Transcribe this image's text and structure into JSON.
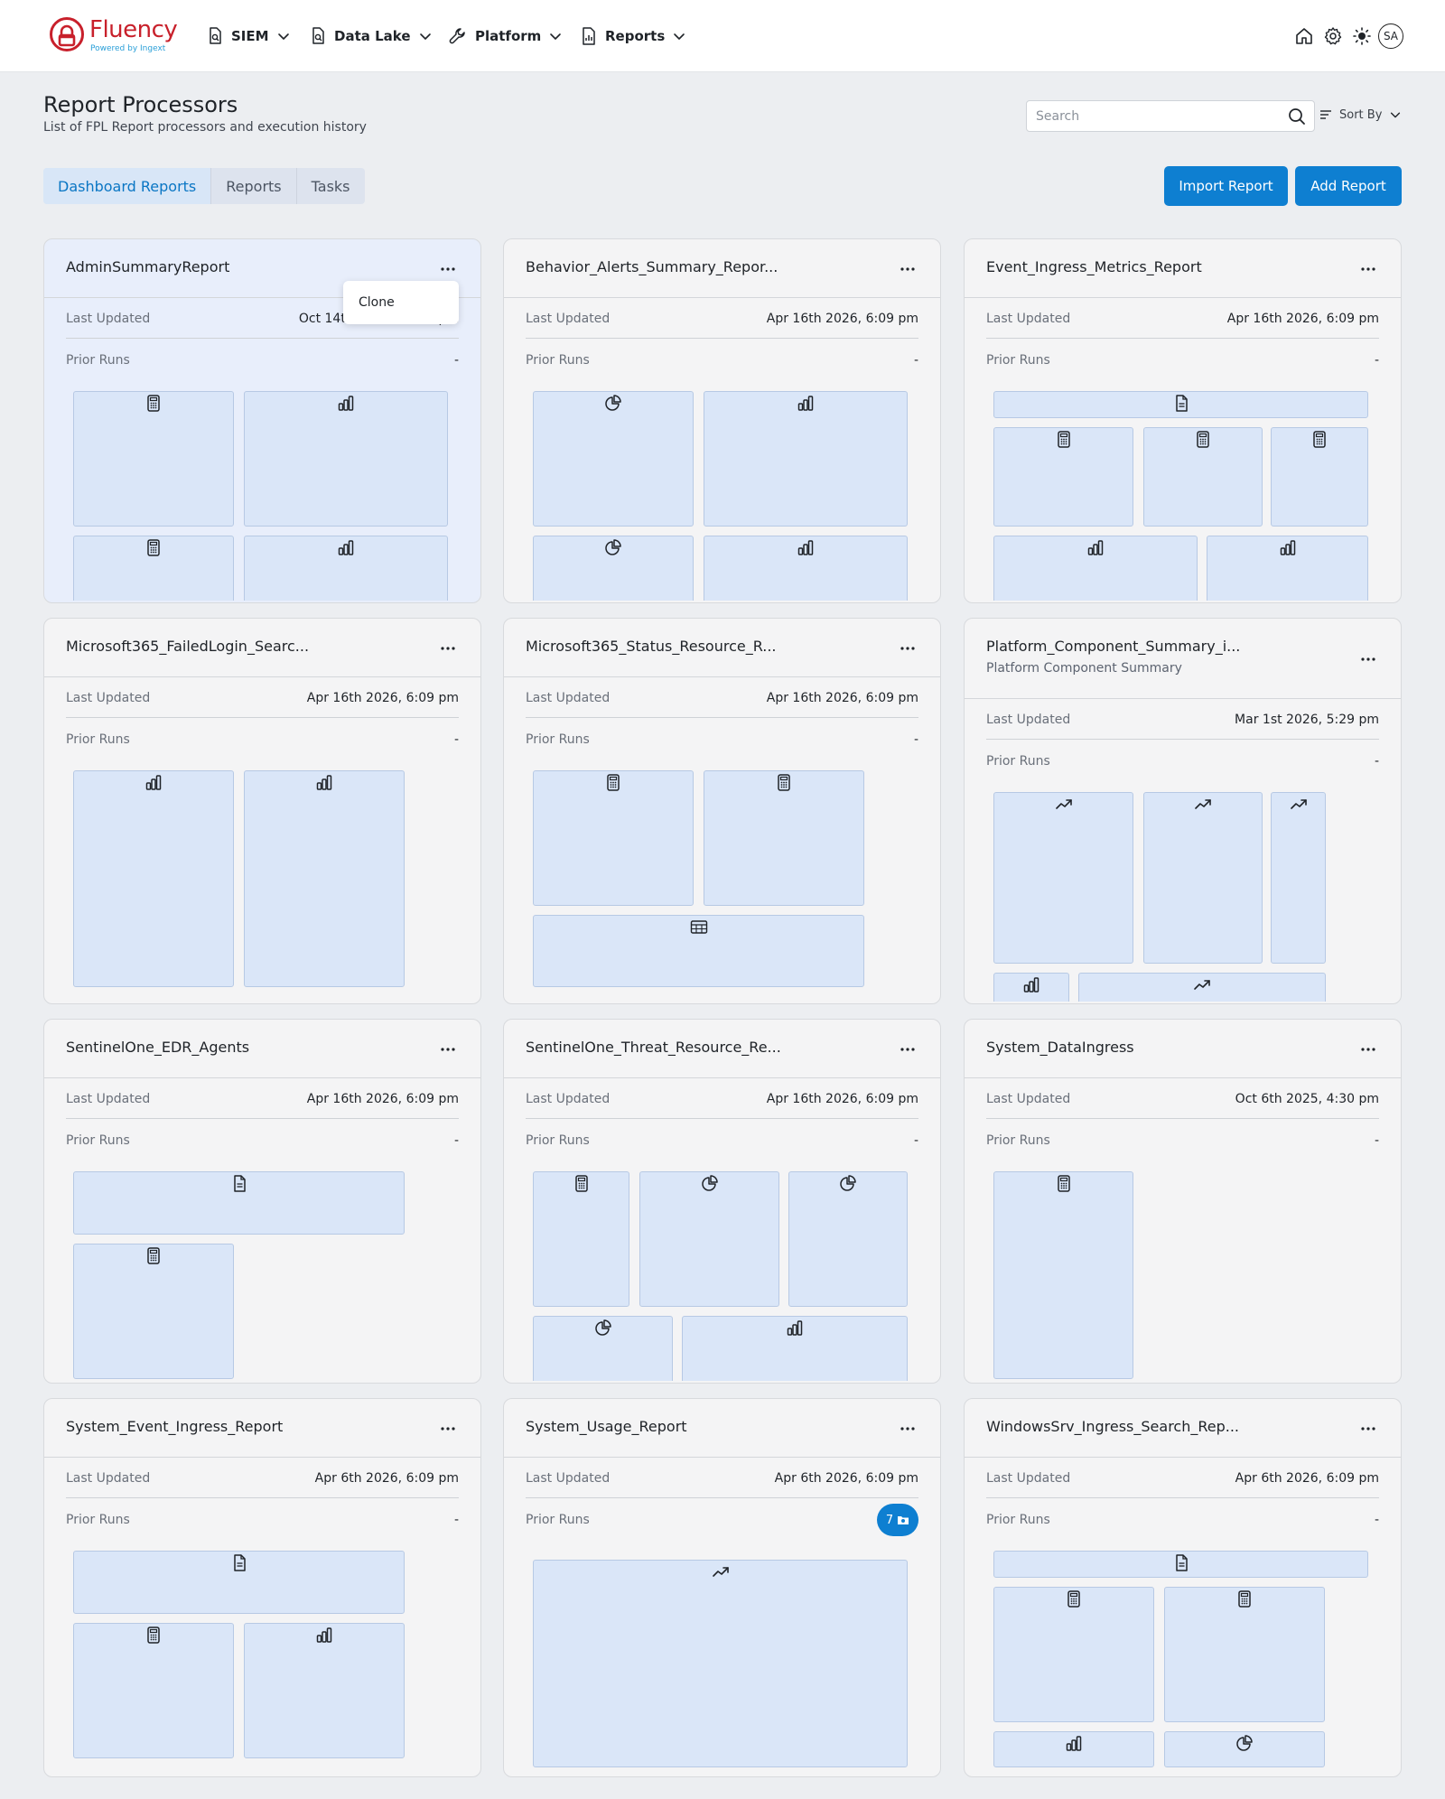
{
  "brand": {
    "name": "Fluency",
    "sub": "Powered by Ingext"
  },
  "nav": [
    {
      "label": "SIEM",
      "icon": "search-doc-icon"
    },
    {
      "label": "Data Lake",
      "icon": "search-doc-icon"
    },
    {
      "label": "Platform",
      "icon": "wrench-icon"
    },
    {
      "label": "Reports",
      "icon": "report-icon"
    }
  ],
  "user": {
    "initials": "SA"
  },
  "page": {
    "title": "Report Processors",
    "subtitle": "List of FPL Report processors and execution history"
  },
  "search": {
    "placeholder": "Search"
  },
  "sort": {
    "label": "Sort By"
  },
  "tabs": [
    "Dashboard Reports",
    "Reports",
    "Tasks"
  ],
  "actions": {
    "import": "Import Report",
    "add": "Add Report"
  },
  "labels": {
    "last_updated": "Last Updated",
    "prior_runs": "Prior Runs"
  },
  "popover": {
    "clone": "Clone"
  },
  "colors": {
    "primary": "#0e7fd1",
    "tile": "#dae6f8",
    "brand": "#c8202b"
  },
  "cards": [
    {
      "title": "AdminSummaryReport",
      "updated": "Oct 14th 2025, 12:29 pm",
      "runs": "-"
    },
    {
      "title": "Behavior_Alerts_Summary_Repor...",
      "updated": "Apr 16th 2026, 6:09 pm",
      "runs": "-"
    },
    {
      "title": "Event_Ingress_Metrics_Report",
      "updated": "Apr 16th 2026, 6:09 pm",
      "runs": "-"
    },
    {
      "title": "Microsoft365_FailedLogin_Searc...",
      "updated": "Apr 16th 2026, 6:09 pm",
      "runs": "-"
    },
    {
      "title": "Microsoft365_Status_Resource_R...",
      "updated": "Apr 16th 2026, 6:09 pm",
      "runs": "-"
    },
    {
      "title": "Platform_Component_Summary_i...",
      "subtitle": "Platform Component Summary",
      "updated": "Mar 1st 2026, 5:29 pm",
      "runs": "-"
    },
    {
      "title": "SentinelOne_EDR_Agents",
      "updated": "Apr 16th 2026, 6:09 pm",
      "runs": "-"
    },
    {
      "title": "SentinelOne_Threat_Resource_Re...",
      "updated": "Apr 16th 2026, 6:09 pm",
      "runs": "-"
    },
    {
      "title": "System_DataIngress",
      "updated": "Oct 6th 2025, 4:30 pm",
      "runs": "-"
    },
    {
      "title": "System_Event_Ingress_Report",
      "updated": "Apr 6th 2026, 6:09 pm",
      "runs": "-"
    },
    {
      "title": "System_Usage_Report",
      "updated": "Apr 6th 2026, 6:09 pm",
      "runs": "7"
    },
    {
      "title": "WindowsSrv_Ingress_Search_Rep...",
      "updated": "Apr 6th 2026, 6:09 pm",
      "runs": "-"
    }
  ]
}
